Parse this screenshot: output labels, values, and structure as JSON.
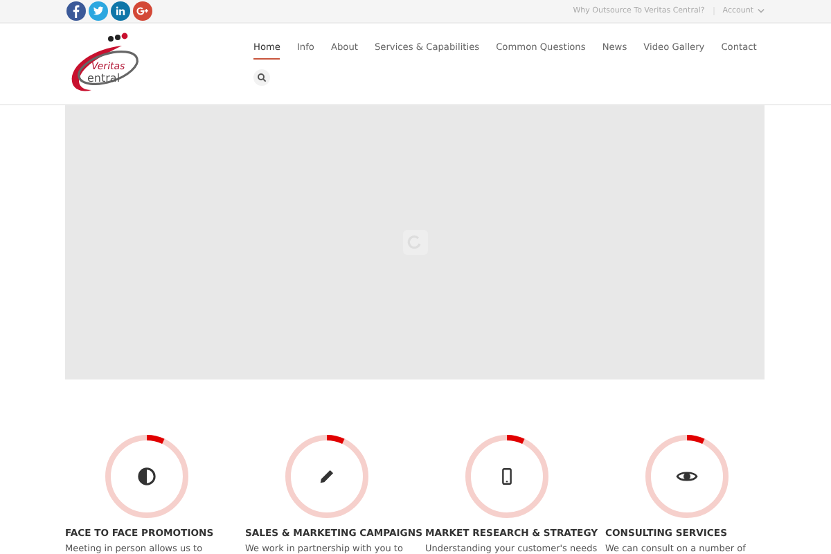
{
  "topbar": {
    "links": [
      {
        "label": "Why Outsource To Veritas Central?",
        "kind": "link"
      },
      {
        "label": "Account",
        "kind": "dropdown"
      }
    ]
  },
  "logo": {
    "line_1": "Veritas",
    "line_2": "entral"
  },
  "nav": [
    {
      "label": "Home",
      "selected": true
    },
    {
      "label": "Info",
      "selected": false
    },
    {
      "label": "About",
      "selected": false
    },
    {
      "label": "Services & Capabilities",
      "selected": false
    },
    {
      "label": "Common Questions",
      "selected": false
    },
    {
      "label": "News",
      "selected": false
    },
    {
      "label": "Video Gallery",
      "selected": false
    },
    {
      "label": "Contact",
      "selected": false
    }
  ],
  "features": [
    {
      "level": 0.07,
      "title": "FACE TO FACE PROMOTIONS",
      "text": "Meeting in person allows us to"
    },
    {
      "level": 0.07,
      "title": "SALES & MARKETING CAMPAIGNS",
      "text": "We work in partnership with you to"
    },
    {
      "level": 0.07,
      "title": "MARKET RESEARCH & STRATEGY",
      "text": "Understanding your customer's needs"
    },
    {
      "level": 0.07,
      "title": "CONSULTING SERVICES",
      "text": "We can consult on a number of"
    }
  ]
}
